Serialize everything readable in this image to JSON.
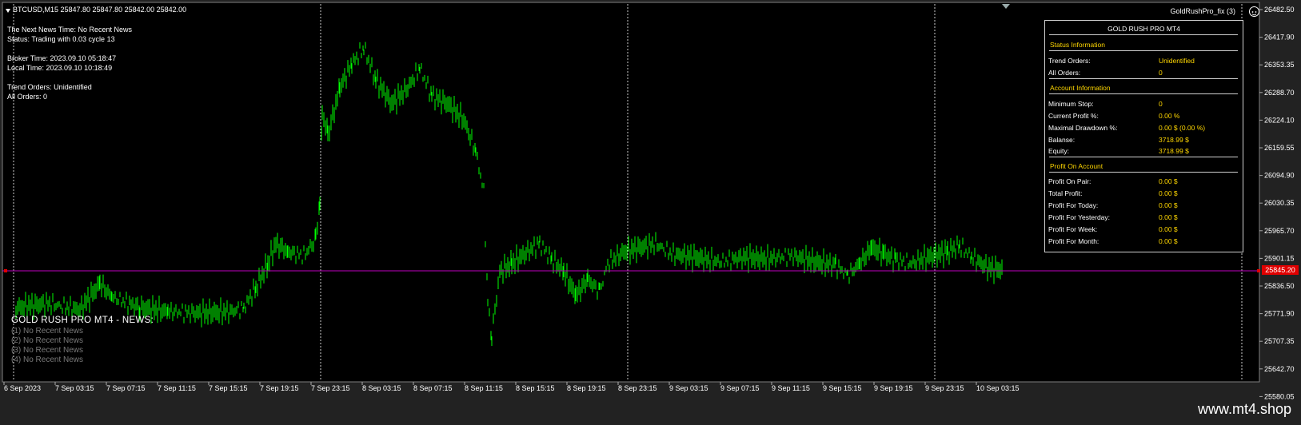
{
  "header": {
    "symbol_line": "BTCUSD,M15  25847.80 25847.80 25842.00 25842.00"
  },
  "info": {
    "news_time": "The Next News Time: No Recent News",
    "status": "Status: Trading with 0.03 cycle 13",
    "broker_time": "Broker Time: 2023.09.10 05:18:47",
    "local_time": "Local Time: 2023.09.10 10:18:49",
    "trend_orders": "Trend Orders: Unidentified",
    "all_orders": "All Orders: 0"
  },
  "ea": {
    "label": "GoldRushPro_fix (3)"
  },
  "news": {
    "title": "GOLD RUSH PRO MT4 - NEWS:",
    "items": [
      "(1)  No Recent News",
      "(2)  No Recent News",
      "(3)  No Recent News",
      "(4)  No Recent News"
    ]
  },
  "panel": {
    "title": "GOLD RUSH PRO MT4",
    "status_section": "Status Information",
    "status_rows": [
      {
        "label": "Trend Orders:",
        "value": "Unidentified"
      },
      {
        "label": "All Orders:",
        "value": "0"
      }
    ],
    "account_section": "Account Information",
    "account_rows": [
      {
        "label": "Minimum Stop:",
        "value": "0"
      },
      {
        "label": "Current Profit %:",
        "value": "0.00 %"
      },
      {
        "label": "Maximal Drawdown %:",
        "value": "0.00 $ (0.00 %)"
      },
      {
        "label": "Balanse:",
        "value": "3718.99 $"
      },
      {
        "label": "Equity:",
        "value": "3718.99 $"
      }
    ],
    "profit_section": "Profit On Account",
    "profit_rows": [
      {
        "label": "Profit On Pair:",
        "value": "0.00 $"
      },
      {
        "label": "Total Profit:",
        "value": "0.00 $"
      },
      {
        "label": "Profit For Today:",
        "value": "0.00 $"
      },
      {
        "label": "Profit For Yesterday:",
        "value": "0.00 $"
      },
      {
        "label": "Profit For Week:",
        "value": "0.00 $"
      },
      {
        "label": "Profit For Month:",
        "value": "0.00 $"
      }
    ]
  },
  "axis": {
    "price_labels": [
      "26482.50",
      "26417.90",
      "26353.35",
      "26288.70",
      "26224.10",
      "26159.55",
      "26094.90",
      "26030.35",
      "25965.70",
      "25901.15",
      "25836.50",
      "25771.90",
      "25707.35",
      "25642.70",
      "25580.05"
    ],
    "time_labels": [
      "6 Sep 2023",
      "7 Sep 03:15",
      "7 Sep 07:15",
      "7 Sep 11:15",
      "7 Sep 15:15",
      "7 Sep 19:15",
      "7 Sep 23:15",
      "8 Sep 03:15",
      "8 Sep 07:15",
      "8 Sep 11:15",
      "8 Sep 15:15",
      "8 Sep 19:15",
      "8 Sep 23:15",
      "9 Sep 03:15",
      "9 Sep 07:15",
      "9 Sep 11:15",
      "9 Sep 15:15",
      "9 Sep 19:15",
      "9 Sep 23:15",
      "10 Sep 03:15"
    ],
    "current_price": "25845.20"
  },
  "colors": {
    "background": "#000000",
    "candles": "#00ff00",
    "price_line": "#c000c0",
    "panel_accent": "#ffd700"
  },
  "watermark": "www.mt4.shop"
}
